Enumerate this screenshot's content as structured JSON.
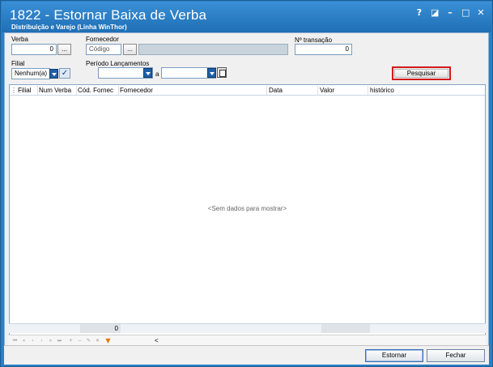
{
  "window": {
    "title": "1822 - Estornar Baixa de Verba",
    "subtitle": "Distribuição e Varejo (Linha WinThor)",
    "controls": [
      "?",
      "◪",
      "–",
      "□",
      "✕"
    ]
  },
  "filters": {
    "verba_label": "Verba",
    "verba_value": "0",
    "browse": "...",
    "fornecedor_label": "Fornecedor",
    "fornecedor_placeholder": "Código",
    "transacao_label": "Nº transação",
    "transacao_value": "0",
    "filial_label": "Filial",
    "filial_value": "Nenhum(a)",
    "periodo_label": "Período Lançamentos",
    "periodo_sep": "a",
    "search_label": "Pesquisar"
  },
  "grid": {
    "columns": [
      "Filial",
      "Num Verba",
      "Cód. Fornec",
      "Fornecedor",
      "Data",
      "Valor",
      "histórico"
    ],
    "empty_text": "<Sem dados para mostrar>",
    "count": "0"
  },
  "nav": {
    "scroll_left": "<"
  },
  "actions": {
    "estornar": "Estornar",
    "fechar": "Fechar"
  }
}
